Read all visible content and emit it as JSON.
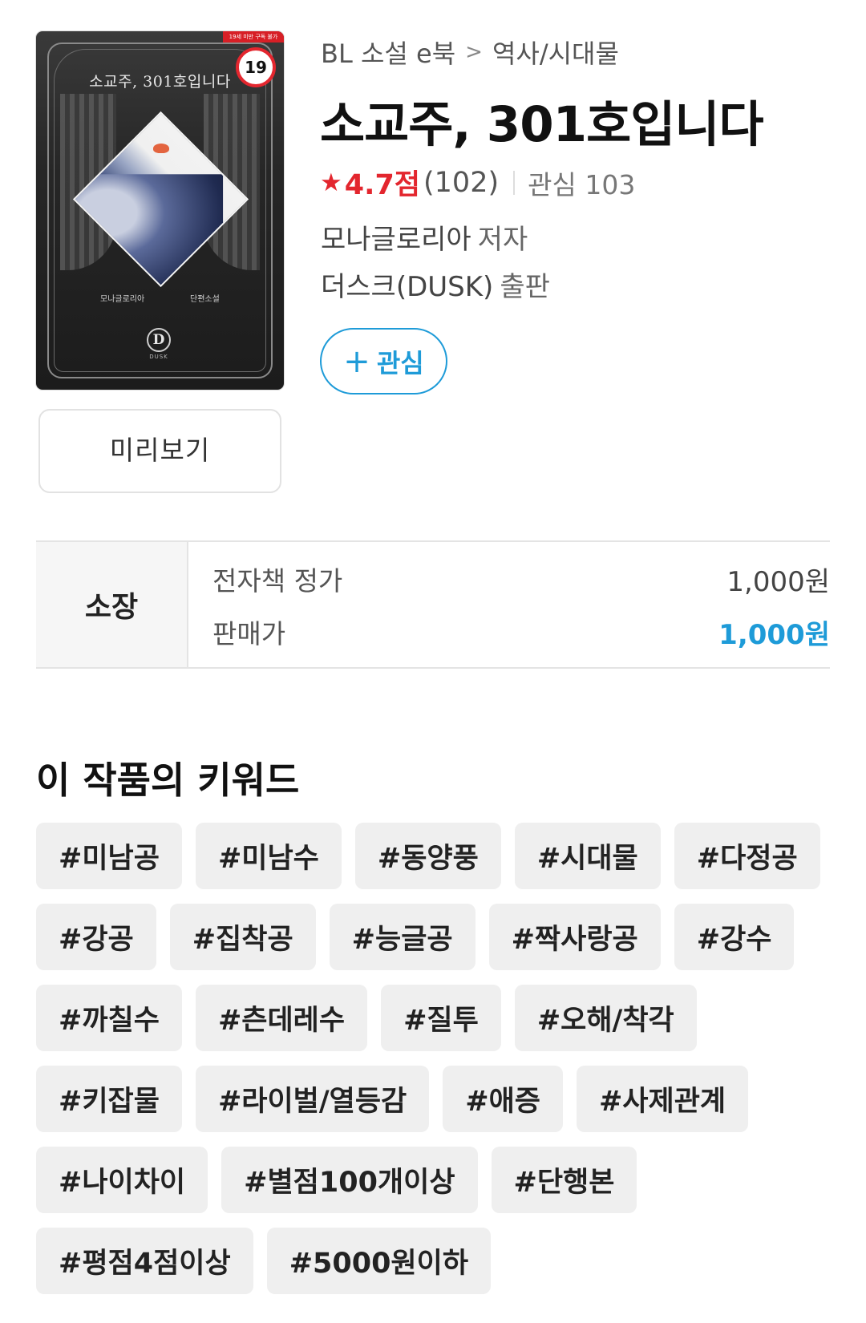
{
  "cover": {
    "title": "소교주, 301호입니다",
    "author": "모나글로리아",
    "genre": "단편소설",
    "adult_strip": "19세 미만 구독 불가",
    "age_badge": "19",
    "logo_letter": "D",
    "logo_text": "DUSK"
  },
  "preview_label": "미리보기",
  "breadcrumb": {
    "category": "BL 소설 e북",
    "separator": ">",
    "subcategory": "역사/시대물"
  },
  "book": {
    "title": "소교주, 301호입니다",
    "rating_icon": "star-icon",
    "rating": "4.7점",
    "rating_count": "(102)",
    "favorites": "관심 103",
    "author": "모나글로리아",
    "author_role": "저자",
    "publisher": "더스크(DUSK)",
    "publisher_role": "출판"
  },
  "fav_button": {
    "plus": "+",
    "label": "관심"
  },
  "price": {
    "type_label": "소장",
    "list_price_label": "전자책 정가",
    "list_price": "1,000원",
    "sale_price_label": "판매가",
    "sale_price": "1,000원"
  },
  "keywords_title": "이 작품의 키워드",
  "keywords": [
    "#미남공",
    "#미남수",
    "#동양풍",
    "#시대물",
    "#다정공",
    "#강공",
    "#집착공",
    "#능글공",
    "#짝사랑공",
    "#강수",
    "#까칠수",
    "#츤데레수",
    "#질투",
    "#오해/착각",
    "#키잡물",
    "#라이벌/열등감",
    "#애증",
    "#사제관계",
    "#나이차이",
    "#별점100개이상",
    "#단행본",
    "#평점4점이상",
    "#5000원이하"
  ],
  "colors": {
    "accent_blue": "#1e9bd8",
    "rating_red": "#e3262e",
    "tag_bg": "#efefef"
  }
}
